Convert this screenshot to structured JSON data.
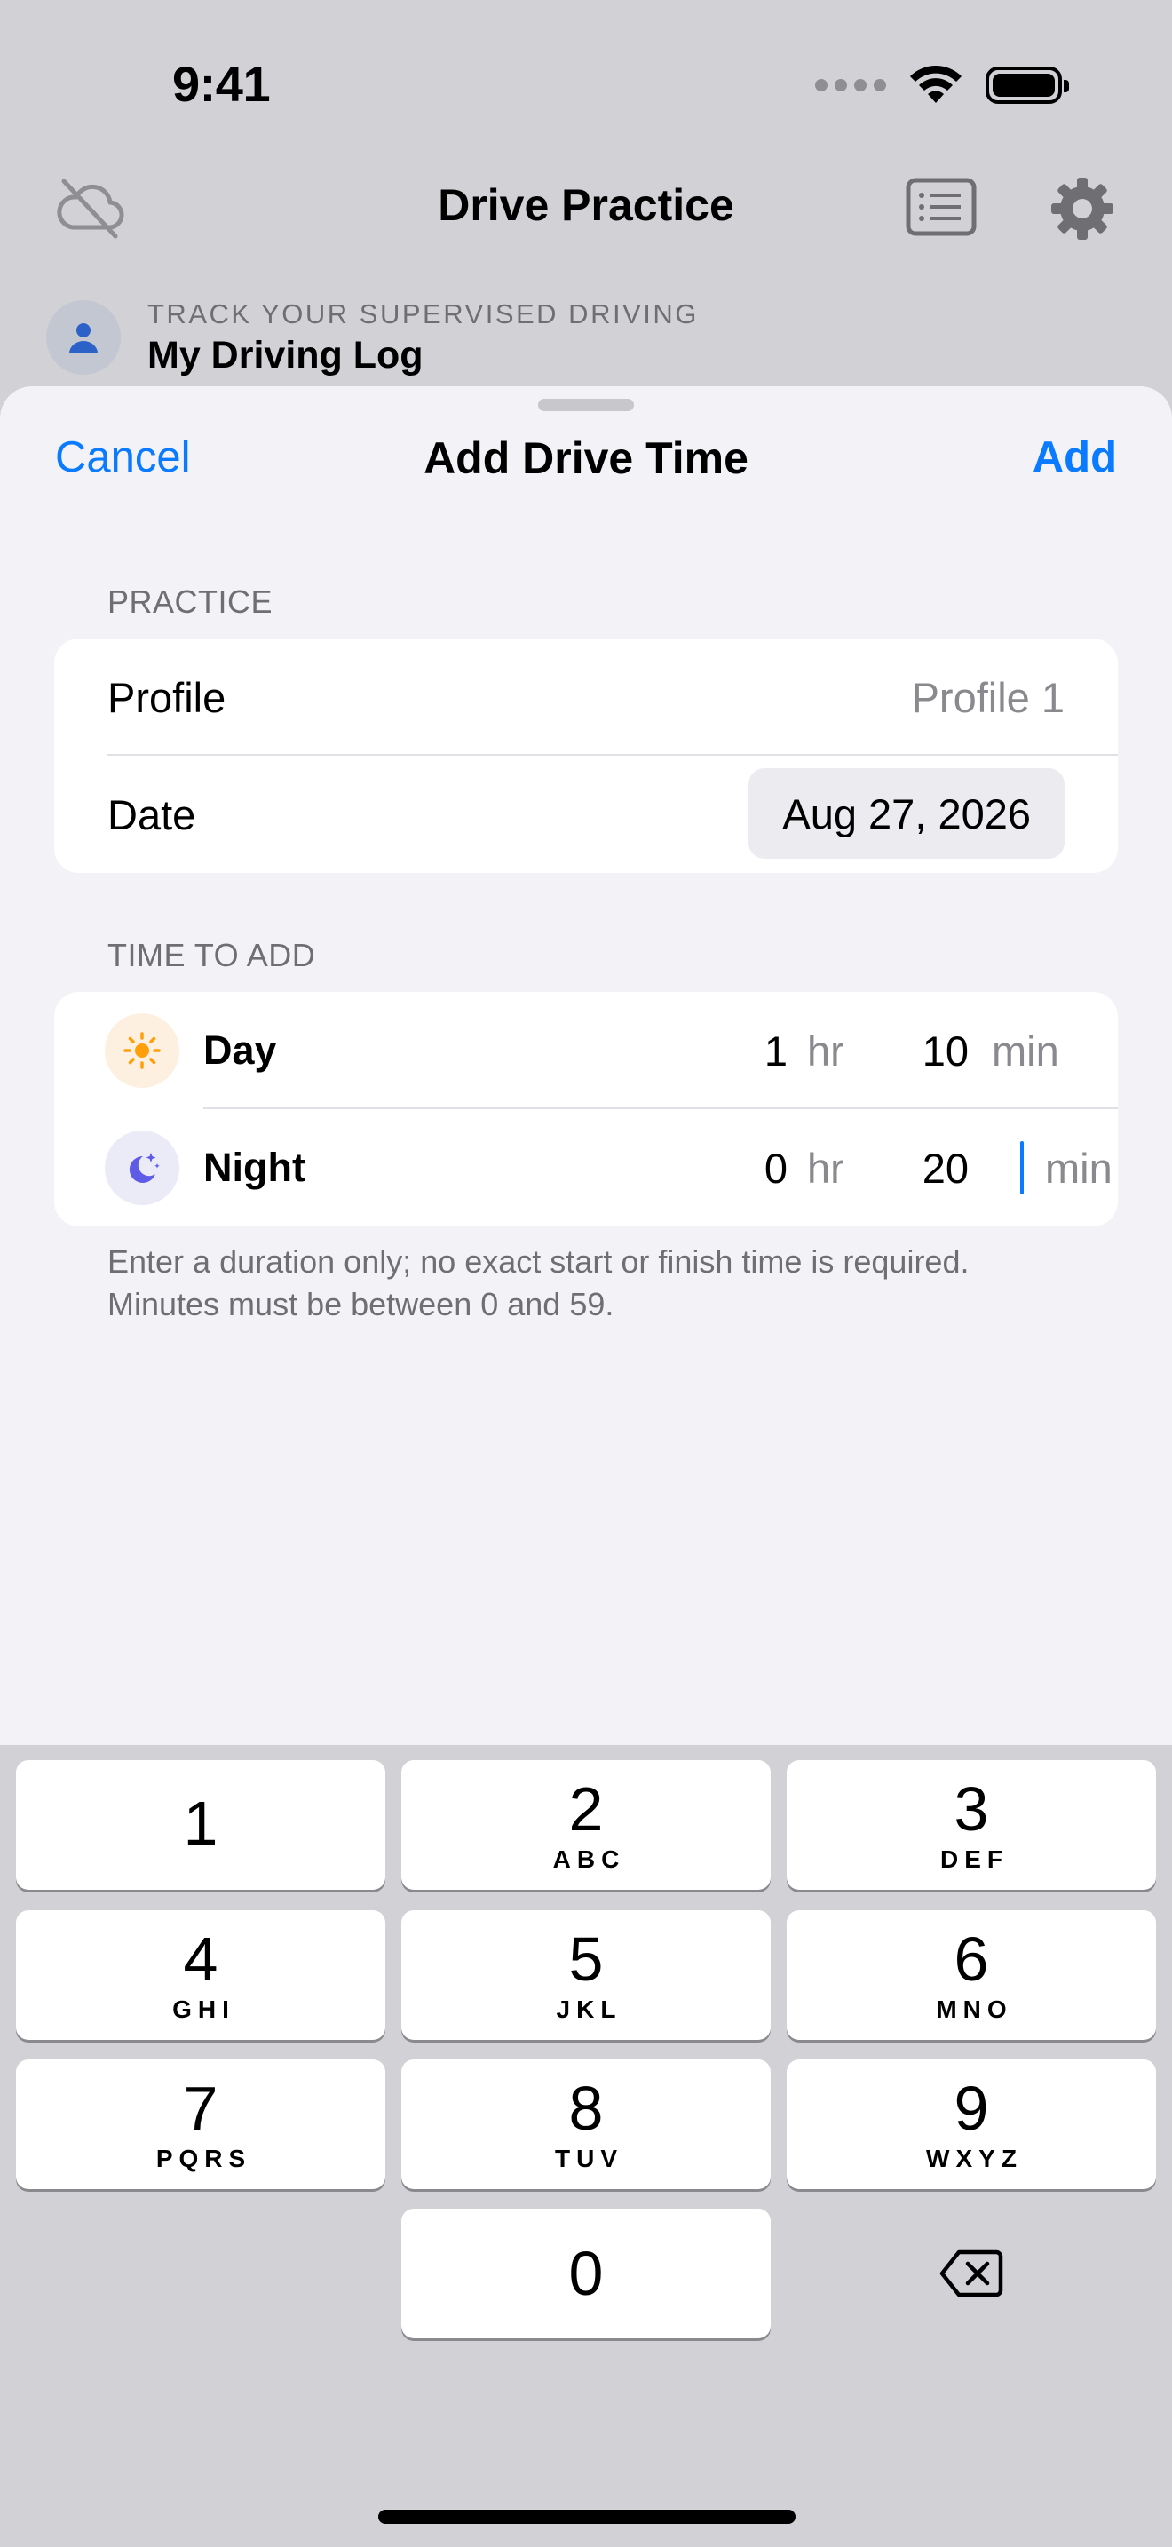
{
  "status_bar": {
    "time": "9:41"
  },
  "app": {
    "title": "Drive Practice",
    "profile_subtitle": "TRACK YOUR SUPERVISED DRIVING",
    "profile_name": "My Driving Log"
  },
  "sheet": {
    "cancel_label": "Cancel",
    "title": "Add Drive Time",
    "add_label": "Add",
    "practice_section": {
      "header": "PRACTICE",
      "profile_label": "Profile",
      "profile_value": "Profile 1",
      "date_label": "Date",
      "date_value": "Aug 27, 2026"
    },
    "time_section": {
      "header": "TIME TO ADD",
      "day": {
        "label": "Day",
        "hours": "1",
        "hours_unit": "hr",
        "minutes": "10",
        "minutes_unit": "min"
      },
      "night": {
        "label": "Night",
        "hours": "0",
        "hours_unit": "hr",
        "minutes": "20",
        "minutes_unit": "min"
      }
    },
    "footnote": "Enter a duration only; no exact start or finish time is required. Minutes must be between 0 and 59."
  },
  "keyboard": {
    "keys": [
      {
        "digit": "1",
        "letters": ""
      },
      {
        "digit": "2",
        "letters": "ABC"
      },
      {
        "digit": "3",
        "letters": "DEF"
      },
      {
        "digit": "4",
        "letters": "GHI"
      },
      {
        "digit": "5",
        "letters": "JKL"
      },
      {
        "digit": "6",
        "letters": "MNO"
      },
      {
        "digit": "7",
        "letters": "PQRS"
      },
      {
        "digit": "8",
        "letters": "TUV"
      },
      {
        "digit": "9",
        "letters": "WXYZ"
      },
      {
        "digit": "0",
        "letters": ""
      }
    ]
  },
  "colors": {
    "accent": "#0a7aff",
    "day_icon": "#ff9f0a",
    "night_icon": "#5e5ce6"
  }
}
